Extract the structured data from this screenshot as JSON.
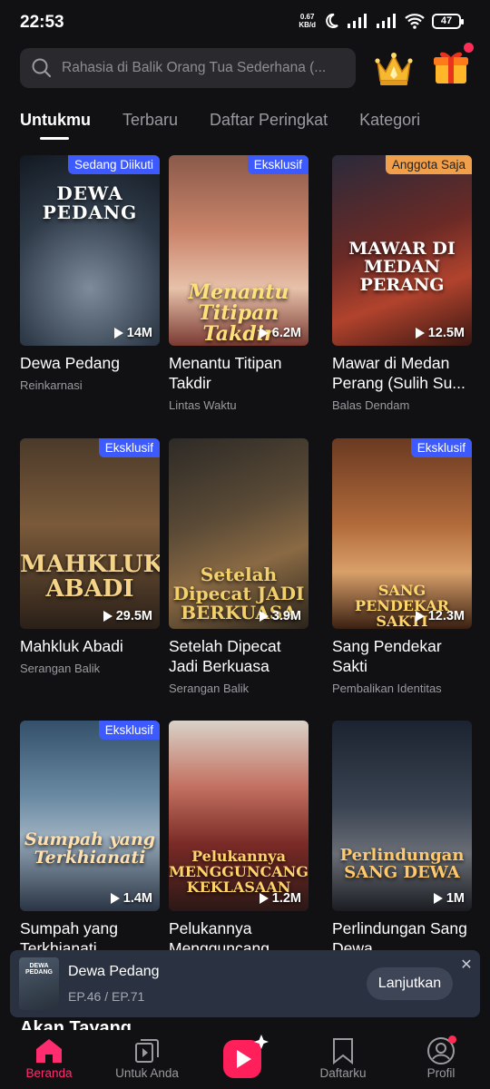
{
  "status": {
    "time": "22:53",
    "speed_value": "0.67",
    "speed_unit": "KB/d",
    "battery": "47"
  },
  "search": {
    "placeholder": "Rahasia di Balik Orang Tua Sederhana (..."
  },
  "tabs": [
    {
      "label": "Untukmu",
      "active": true
    },
    {
      "label": "Terbaru",
      "active": false
    },
    {
      "label": "Daftar Peringkat",
      "active": false
    },
    {
      "label": "Kategori",
      "active": false
    }
  ],
  "dramas": [
    {
      "title": "Dewa Pedang",
      "genre": "Reinkarnasi",
      "views": "14M",
      "badge": "Sedang Diikuti",
      "poster_text": "DEWA PEDANG"
    },
    {
      "title": "Menantu Titipan Takdir",
      "genre": "Lintas Waktu",
      "views": "6.2M",
      "badge": "Eksklusif",
      "poster_text": "Menantu Titipan Takdir"
    },
    {
      "title": "Mawar di Medan Perang (Sulih Su...",
      "genre": "Balas Dendam",
      "views": "12.5M",
      "badge": "Anggota Saja",
      "poster_text": "MAWAR DI MEDAN PERANG"
    },
    {
      "title": "Mahkluk Abadi",
      "genre": "Serangan Balik",
      "views": "29.5M",
      "badge": "Eksklusif",
      "poster_text": "MAHKLUK ABADI"
    },
    {
      "title": "Setelah Dipecat Jadi Berkuasa",
      "genre": "Serangan Balik",
      "views": "3.9M",
      "badge": "",
      "poster_text": "Setelah Dipecat JADI BERKUASA"
    },
    {
      "title": "Sang Pendekar Sakti",
      "genre": "Pembalikan Identitas",
      "views": "12.3M",
      "badge": "Eksklusif",
      "poster_text": "SANG PENDEKAR SAKTI"
    },
    {
      "title": "Sumpah yang Terkhianati",
      "genre": "",
      "views": "1.4M",
      "badge": "Eksklusif",
      "poster_text": "Sumpah yang Terkhianati"
    },
    {
      "title": "Pelukannya Mengguncang Kek...",
      "genre": "",
      "views": "1.2M",
      "badge": "",
      "poster_text": "Pelukannya MENGGUNCANG KEKLASAAN"
    },
    {
      "title": "Perlindungan Sang Dewa",
      "genre": "",
      "views": "1M",
      "badge": "",
      "poster_text": "Perlindungan SANG DEWA"
    }
  ],
  "continue_watching": {
    "title": "Dewa Pedang",
    "episode": "EP.46 / EP.71",
    "button": "Lanjutkan",
    "thumb_text": "DEWA PEDANG"
  },
  "section_peek": "Akan Tayang",
  "nav": [
    {
      "label": "Beranda",
      "icon": "home-icon",
      "active": true
    },
    {
      "label": "Untuk Anda",
      "icon": "play-stack-icon",
      "active": false
    },
    {
      "label": "",
      "icon": "shorts-play-icon",
      "active": false
    },
    {
      "label": "Daftarku",
      "icon": "bookmark-icon",
      "active": false
    },
    {
      "label": "Profil",
      "icon": "profile-icon",
      "active": false
    }
  ],
  "colors": {
    "accent": "#ff2d6f",
    "badge_blue": "#3d5afe",
    "badge_orange": "#f0a04b",
    "background": "#111113"
  }
}
